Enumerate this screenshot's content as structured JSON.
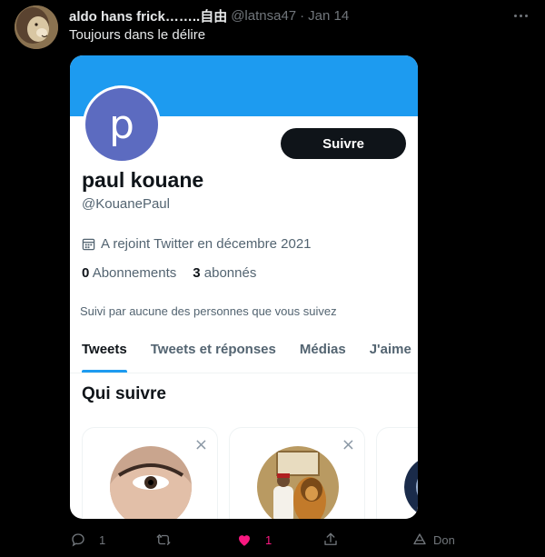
{
  "tweet": {
    "author_name": "aldo hans frick……..自由",
    "author_handle": "@latnsa47",
    "separator": "·",
    "date": "Jan 14",
    "text": "Toujours dans le délire"
  },
  "embedded_profile": {
    "avatar_letter": "p",
    "follow_label": "Suivre",
    "name": "paul kouane",
    "handle": "@KouanePaul",
    "joined": "A rejoint Twitter en décembre 2021",
    "following_count": "0",
    "following_label": "Abonnements",
    "followers_count": "3",
    "followers_label": "abonnés",
    "followed_by": "Suivi par aucune des personnes que vous suivez",
    "tabs": [
      "Tweets",
      "Tweets et réponses",
      "Médias",
      "J'aime"
    ],
    "who_to_follow": "Qui suivre",
    "suggestion_close": "×"
  },
  "actions": {
    "reply_count": "1",
    "retweet_count": "",
    "like_count": "1",
    "tip_label": "Don"
  },
  "colors": {
    "accent": "#1d9bf0",
    "like": "#f91880",
    "avatar_bg": "#5c6bc0"
  }
}
